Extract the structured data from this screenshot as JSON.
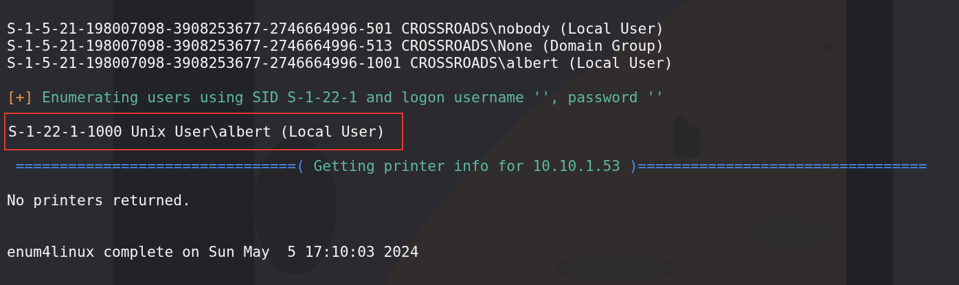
{
  "terminal": {
    "lines": [
      {
        "kind": "output",
        "text": "S-1-5-21-198007098-3908253677-2746664996-501 CROSSROADS\\nobody (Local User)",
        "boxed": false
      },
      {
        "kind": "output",
        "text": "S-1-5-21-198007098-3908253677-2746664996-513 CROSSROADS\\None (Domain Group)",
        "boxed": false
      },
      {
        "kind": "output",
        "text": "S-1-5-21-198007098-3908253677-2746664996-1001 CROSSROADS\\albert (Local User)",
        "boxed": false
      },
      {
        "kind": "blank"
      },
      {
        "kind": "status",
        "marker": "[+]",
        "text": "Enumerating users using SID S-1-22-1 and logon username '', password ''"
      },
      {
        "kind": "blank"
      },
      {
        "kind": "output",
        "text": "S-1-22-1-1000 Unix User\\albert (Local User)",
        "boxed": true
      },
      {
        "kind": "blank"
      },
      {
        "kind": "banner",
        "left": "================================(",
        "title": " Getting printer info for 10.10.1.53 ",
        "right": ")================================="
      },
      {
        "kind": "blank"
      },
      {
        "kind": "output",
        "text": "No printers returned.",
        "boxed": false
      },
      {
        "kind": "blank"
      },
      {
        "kind": "blank"
      },
      {
        "kind": "output",
        "text": "enum4linux complete on Sun May  5 17:10:03 2024",
        "boxed": false
      }
    ]
  }
}
